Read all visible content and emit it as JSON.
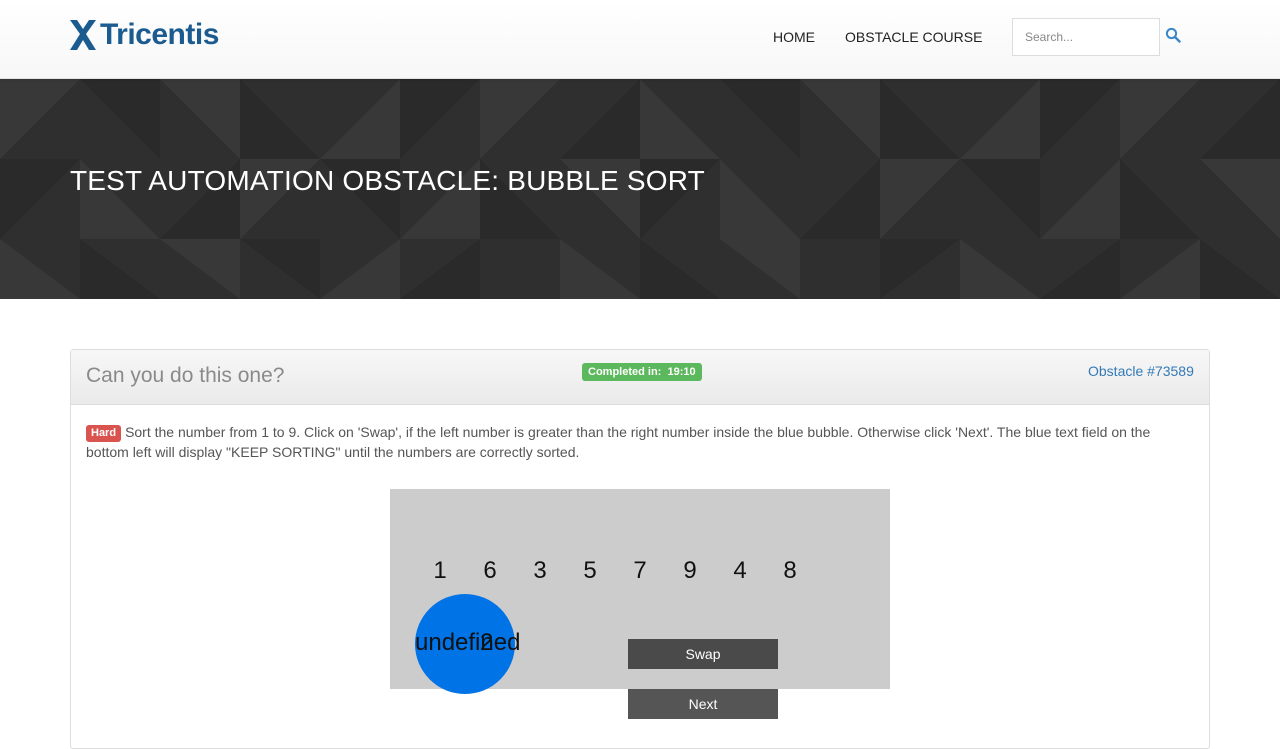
{
  "header": {
    "logo_text": "Tricentis",
    "nav": {
      "home": "HOME",
      "obstacle_course": "OBSTACLE COURSE"
    },
    "search": {
      "placeholder": "Search...",
      "value": ""
    },
    "icons": {
      "logo": "tricentis-x-logo-icon",
      "search": "search-icon"
    }
  },
  "hero": {
    "title": "TEST AUTOMATION OBSTACLE: BUBBLE SORT"
  },
  "panel": {
    "title": "Can you do this one?",
    "completed_label": "Completed in:",
    "completed_time": "19:10",
    "obstacle_link": "Obstacle #73589",
    "difficulty": "Hard",
    "description": "Sort the number from 1 to 9. Click on 'Swap', if the left number is greater than the right number inside the blue bubble. Otherwise click 'Next'. The blue text field on the bottom left will display \"KEEP SORTING\" until the numbers are correctly sorted."
  },
  "game": {
    "numbers": [
      "1",
      "6",
      "3",
      "5",
      "7",
      "9",
      "4",
      "8"
    ],
    "bubble_text": "undefined",
    "bubble_overlay": "2",
    "swap_label": "Swap",
    "next_label": "Next"
  },
  "colors": {
    "brand": "#1b5b8f",
    "link": "#337ab7",
    "success": "#5cb85c",
    "danger": "#d9534f",
    "bubble": "#0073e6",
    "game_bg": "#cccccc",
    "hero_bg": "#2f2f2f"
  }
}
